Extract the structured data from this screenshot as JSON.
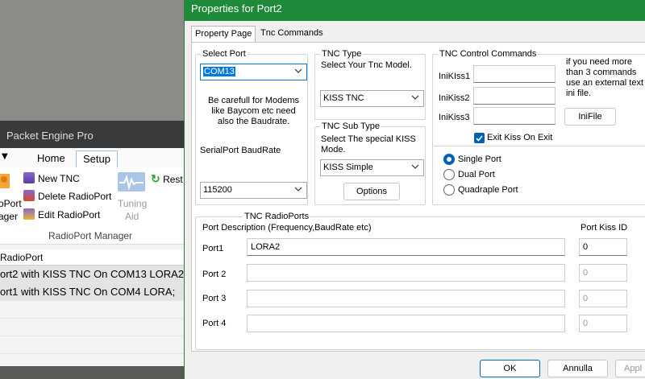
{
  "background_app": {
    "title": "Packet Engine Pro",
    "menu_tabs": [
      "Home",
      "Setup"
    ],
    "ribbon": {
      "new_tnc": "New TNC",
      "delete_radioport": "Delete RadioPort",
      "edit_radioport": "Edit RadioPort",
      "left_big_label_1": "oPort",
      "left_big_label_2": "ager",
      "tuning_aid_1": "Tuning",
      "tuning_aid_2": "Aid",
      "restart_fragment": "Rest",
      "group_label": "RadioPort Manager"
    },
    "list": {
      "header": "RadioPort",
      "rows": [
        "ort2 with KISS TNC On COM13 LORA2;",
        "ort1 with KISS TNC On COM4 LORA;"
      ]
    }
  },
  "dialog": {
    "title": "Properties for Port2",
    "tabs": [
      "Property Page",
      "Tnc Commands"
    ],
    "select_port": {
      "legend": "Select Port",
      "value": "COM13",
      "warning": "Be carefull for Modems like Baycom etc need also the Baudrate.",
      "baud_label": "SerialPort BaudRate",
      "baud_value": "115200"
    },
    "tnc_type": {
      "legend": "TNC Type",
      "hint": "Select Your Tnc Model.",
      "value": "KISS TNC"
    },
    "tnc_sub_type": {
      "legend": "TNC Sub Type",
      "hint": "Select The special KISS Mode.",
      "value": "KISS Simple",
      "options_button": "Options"
    },
    "tnc_control": {
      "legend": "TNC Control Commands",
      "labels": [
        "IniKIss1",
        "IniKiss2",
        "IniKiss3"
      ],
      "note": "if you need more than 3 commands use an external text ini file.",
      "inifile_button": "IniFile",
      "exit_kiss_label": "Exit Kiss On Exit",
      "exit_kiss_checked": true,
      "port_modes": [
        "Single Port",
        "Dual Port",
        "Quadraple Port"
      ],
      "selected_mode": "Single Port"
    },
    "radioports": {
      "legend": "TNC RadioPorts",
      "desc_header": "Port Description (Frequency,BaudRate etc)",
      "kiss_header": "Port Kiss ID",
      "rows": [
        {
          "label": "Port1",
          "desc": "LORA2",
          "kiss": "0"
        },
        {
          "label": "Port 2",
          "desc": "",
          "kiss": "0"
        },
        {
          "label": "Port 3",
          "desc": "",
          "kiss": "0"
        },
        {
          "label": "Port 4",
          "desc": "",
          "kiss": "0"
        }
      ]
    },
    "footer": {
      "ok": "OK",
      "cancel": "Annulla",
      "apply": "Appl"
    }
  }
}
